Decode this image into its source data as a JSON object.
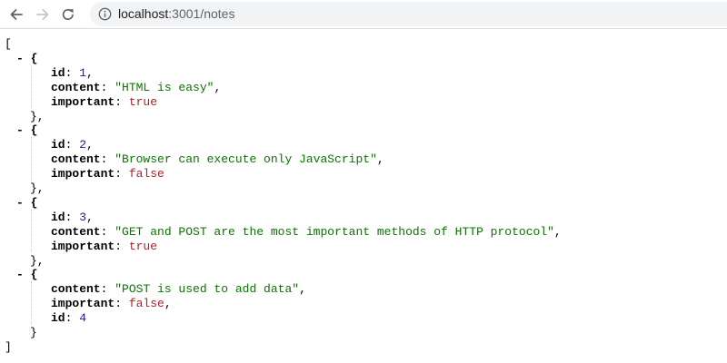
{
  "browser": {
    "url_host": "localhost",
    "url_rest": ":3001/notes"
  },
  "json_view": {
    "open_bracket": "[",
    "close_bracket": "]",
    "toggle": "- {",
    "obj_close_comma": "},",
    "obj_close": "}",
    "colon": ": ",
    "comma": ",",
    "notes": [
      {
        "fields": [
          {
            "key": "id",
            "value": "1",
            "type": "num",
            "comma": true
          },
          {
            "key": "content",
            "value": "\"HTML is easy\"",
            "type": "str",
            "comma": true
          },
          {
            "key": "important",
            "value": "true",
            "type": "bool",
            "comma": false
          }
        ]
      },
      {
        "fields": [
          {
            "key": "id",
            "value": "2",
            "type": "num",
            "comma": true
          },
          {
            "key": "content",
            "value": "\"Browser can execute only JavaScript\"",
            "type": "str",
            "comma": true
          },
          {
            "key": "important",
            "value": "false",
            "type": "bool",
            "comma": false
          }
        ]
      },
      {
        "fields": [
          {
            "key": "id",
            "value": "3",
            "type": "num",
            "comma": true
          },
          {
            "key": "content",
            "value": "\"GET and POST are the most important methods of HTTP protocol\"",
            "type": "str",
            "comma": true
          },
          {
            "key": "important",
            "value": "true",
            "type": "bool",
            "comma": false
          }
        ]
      },
      {
        "fields": [
          {
            "key": "content",
            "value": "\"POST is used to add data\"",
            "type": "str",
            "comma": true
          },
          {
            "key": "important",
            "value": "false",
            "type": "bool",
            "comma": true
          },
          {
            "key": "id",
            "value": "4",
            "type": "num",
            "comma": false
          }
        ]
      }
    ]
  }
}
